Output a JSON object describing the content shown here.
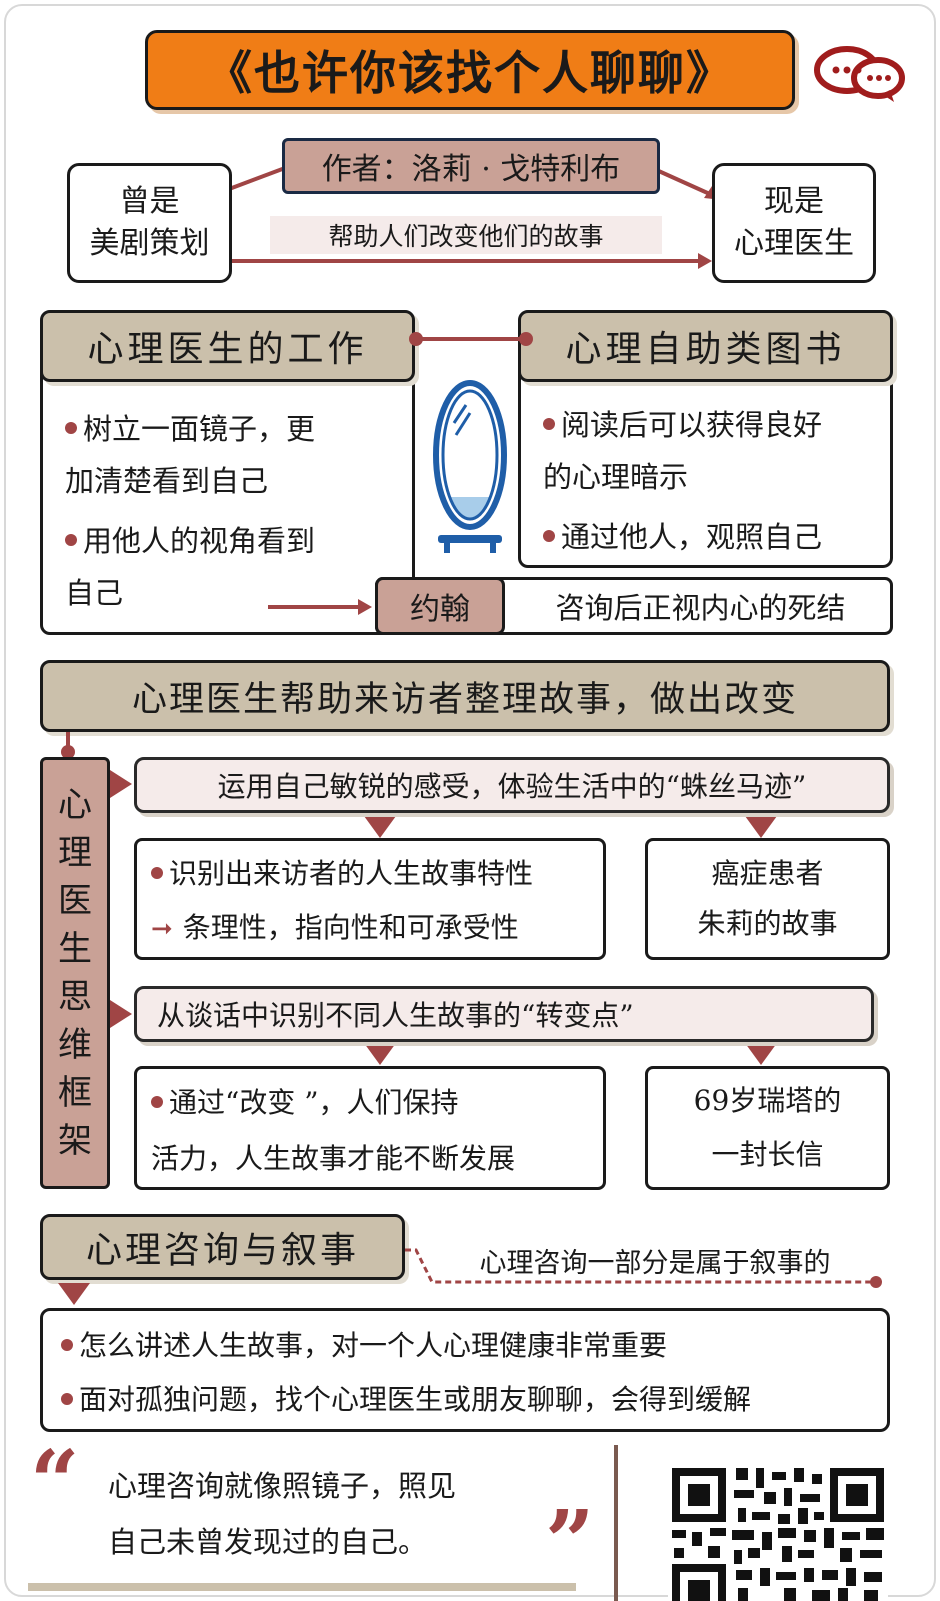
{
  "title": "《也许你该找个人聊聊》",
  "author": {
    "label": "作者：洛莉 · 戈特利布",
    "past_line1": "曾是",
    "past_line2": "美剧策划",
    "now_line1": "现是",
    "now_line2": "心理医生",
    "mission": "帮助人们改变他们的故事"
  },
  "work": {
    "header": "心理医生的工作",
    "item1_line1": "树立一面镜子，更",
    "item1_line2": "加清楚看到自己",
    "item2_line1": "用他人的视角看到",
    "item2_line2": "自己"
  },
  "selfhelp": {
    "header": "心理自助类图书",
    "item1_line1": "阅读后可以获得良好",
    "item1_line2": "的心理暗示",
    "item2": "通过他人，观照自己"
  },
  "john": {
    "name": "约翰",
    "text": "咨询后正视内心的死结"
  },
  "framework": {
    "banner": "心理医生帮助来访者整理故事，做出改变",
    "side_label": [
      "心",
      "理",
      "医",
      "生",
      "思",
      "维",
      "框",
      "架"
    ],
    "step1": "运用自己敏锐的感受，体验生活中的“蛛丝马迹”",
    "step1_item1": "识别出来访者的人生故事特性",
    "step1_item2": "条理性，指向性和可承受性",
    "step1_case_line1": "癌症患者",
    "step1_case_line2": "朱莉的故事",
    "step2": "从谈话中识别不同人生故事的“转变点”",
    "step2_item_line1": "通过“改变 ”，人们保持",
    "step2_item_line2": "活力，人生故事才能不断发展",
    "step2_case_line1": "69岁瑞塔的",
    "step2_case_line2": "一封长信"
  },
  "narrative": {
    "header": "心理咨询与叙事",
    "note": "心理咨询一部分是属于叙事的",
    "item1": "怎么讲述人生故事，对一个人心理健康非常重要",
    "item2": "面对孤独问题，找个心理医生或朋友聊聊，会得到缓解"
  },
  "quote": {
    "open_mark": "“",
    "close_mark": "”",
    "line1": "心理咨询就像照镜子，照见",
    "line2": "自己未曾发现过的自己。"
  },
  "icons": [
    "chat-bubbles-icon",
    "mirror-icon",
    "qr-code-icon"
  ],
  "colors": {
    "title_bg": "#f07d16",
    "accent_red": "#a04545",
    "tan": "#cbc0ab",
    "author_bg": "#c9a196",
    "pink": "#f5ebea"
  }
}
